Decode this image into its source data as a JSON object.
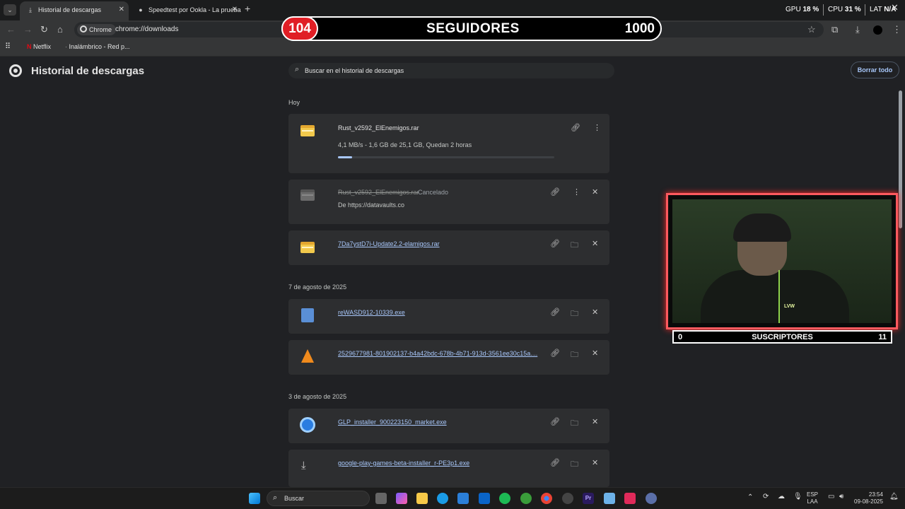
{
  "tabs": [
    {
      "title": "Historial de descargas",
      "icon": "download-icon",
      "active": true
    },
    {
      "title": "Speedtest por Ookla - La prueba",
      "icon": "github-icon",
      "active": false
    }
  ],
  "sys": {
    "gpu_label": "GPU",
    "gpu_val": "18 %",
    "cpu_label": "CPU",
    "cpu_val": "31 %",
    "lat_label": "LAT",
    "lat_val": "N/A"
  },
  "toolbar": {
    "chip": "Chrome",
    "url": "chrome://downloads"
  },
  "bookmarks": [
    {
      "label": "Netflix"
    },
    {
      "label": "Inalámbrico - Red p..."
    }
  ],
  "overlay": {
    "followers_count": "104",
    "followers_label": "SEGUIDORES",
    "followers_goal": "1000",
    "subs_count": "0",
    "subs_label": "SUSCRIPTORES",
    "subs_goal": "11"
  },
  "page": {
    "title": "Historial de descargas",
    "search_placeholder": "Buscar en el historial de descargas",
    "clear_all": "Borrar todo",
    "sections": [
      {
        "label": "Hoy"
      },
      {
        "label": "7 de agosto de 2025"
      },
      {
        "label": "3 de agosto de 2025"
      }
    ],
    "downloads": [
      {
        "name": "Rust_v2592_ElEnemigos.rar",
        "detail": "4,1 MB/s - 1,6 GB de 25,1 GB, Quedan 2 horas",
        "progress": 0.064
      },
      {
        "name": "Rust_v2592_ElEnemigos.rar",
        "status": "Cancelado",
        "detail": "De https://datavaults.co"
      },
      {
        "name": "7Da7ystD7i-Update2.2-elamigos.rar"
      },
      {
        "name": "reWASD912-10339.exe"
      },
      {
        "name": "2529677981-801902137-b4a42bdc-678b-4b71-913d-3561ee30c15a...."
      },
      {
        "name": "GLP_installer_900223150_market.exe"
      },
      {
        "name": "google-play-games-beta-installer_r-PE3p1.exe"
      }
    ]
  },
  "taskbar": {
    "search": "Buscar",
    "lang1": "ESP",
    "lang2": "LAA",
    "time": "23:54",
    "date": "09-08-2025"
  }
}
